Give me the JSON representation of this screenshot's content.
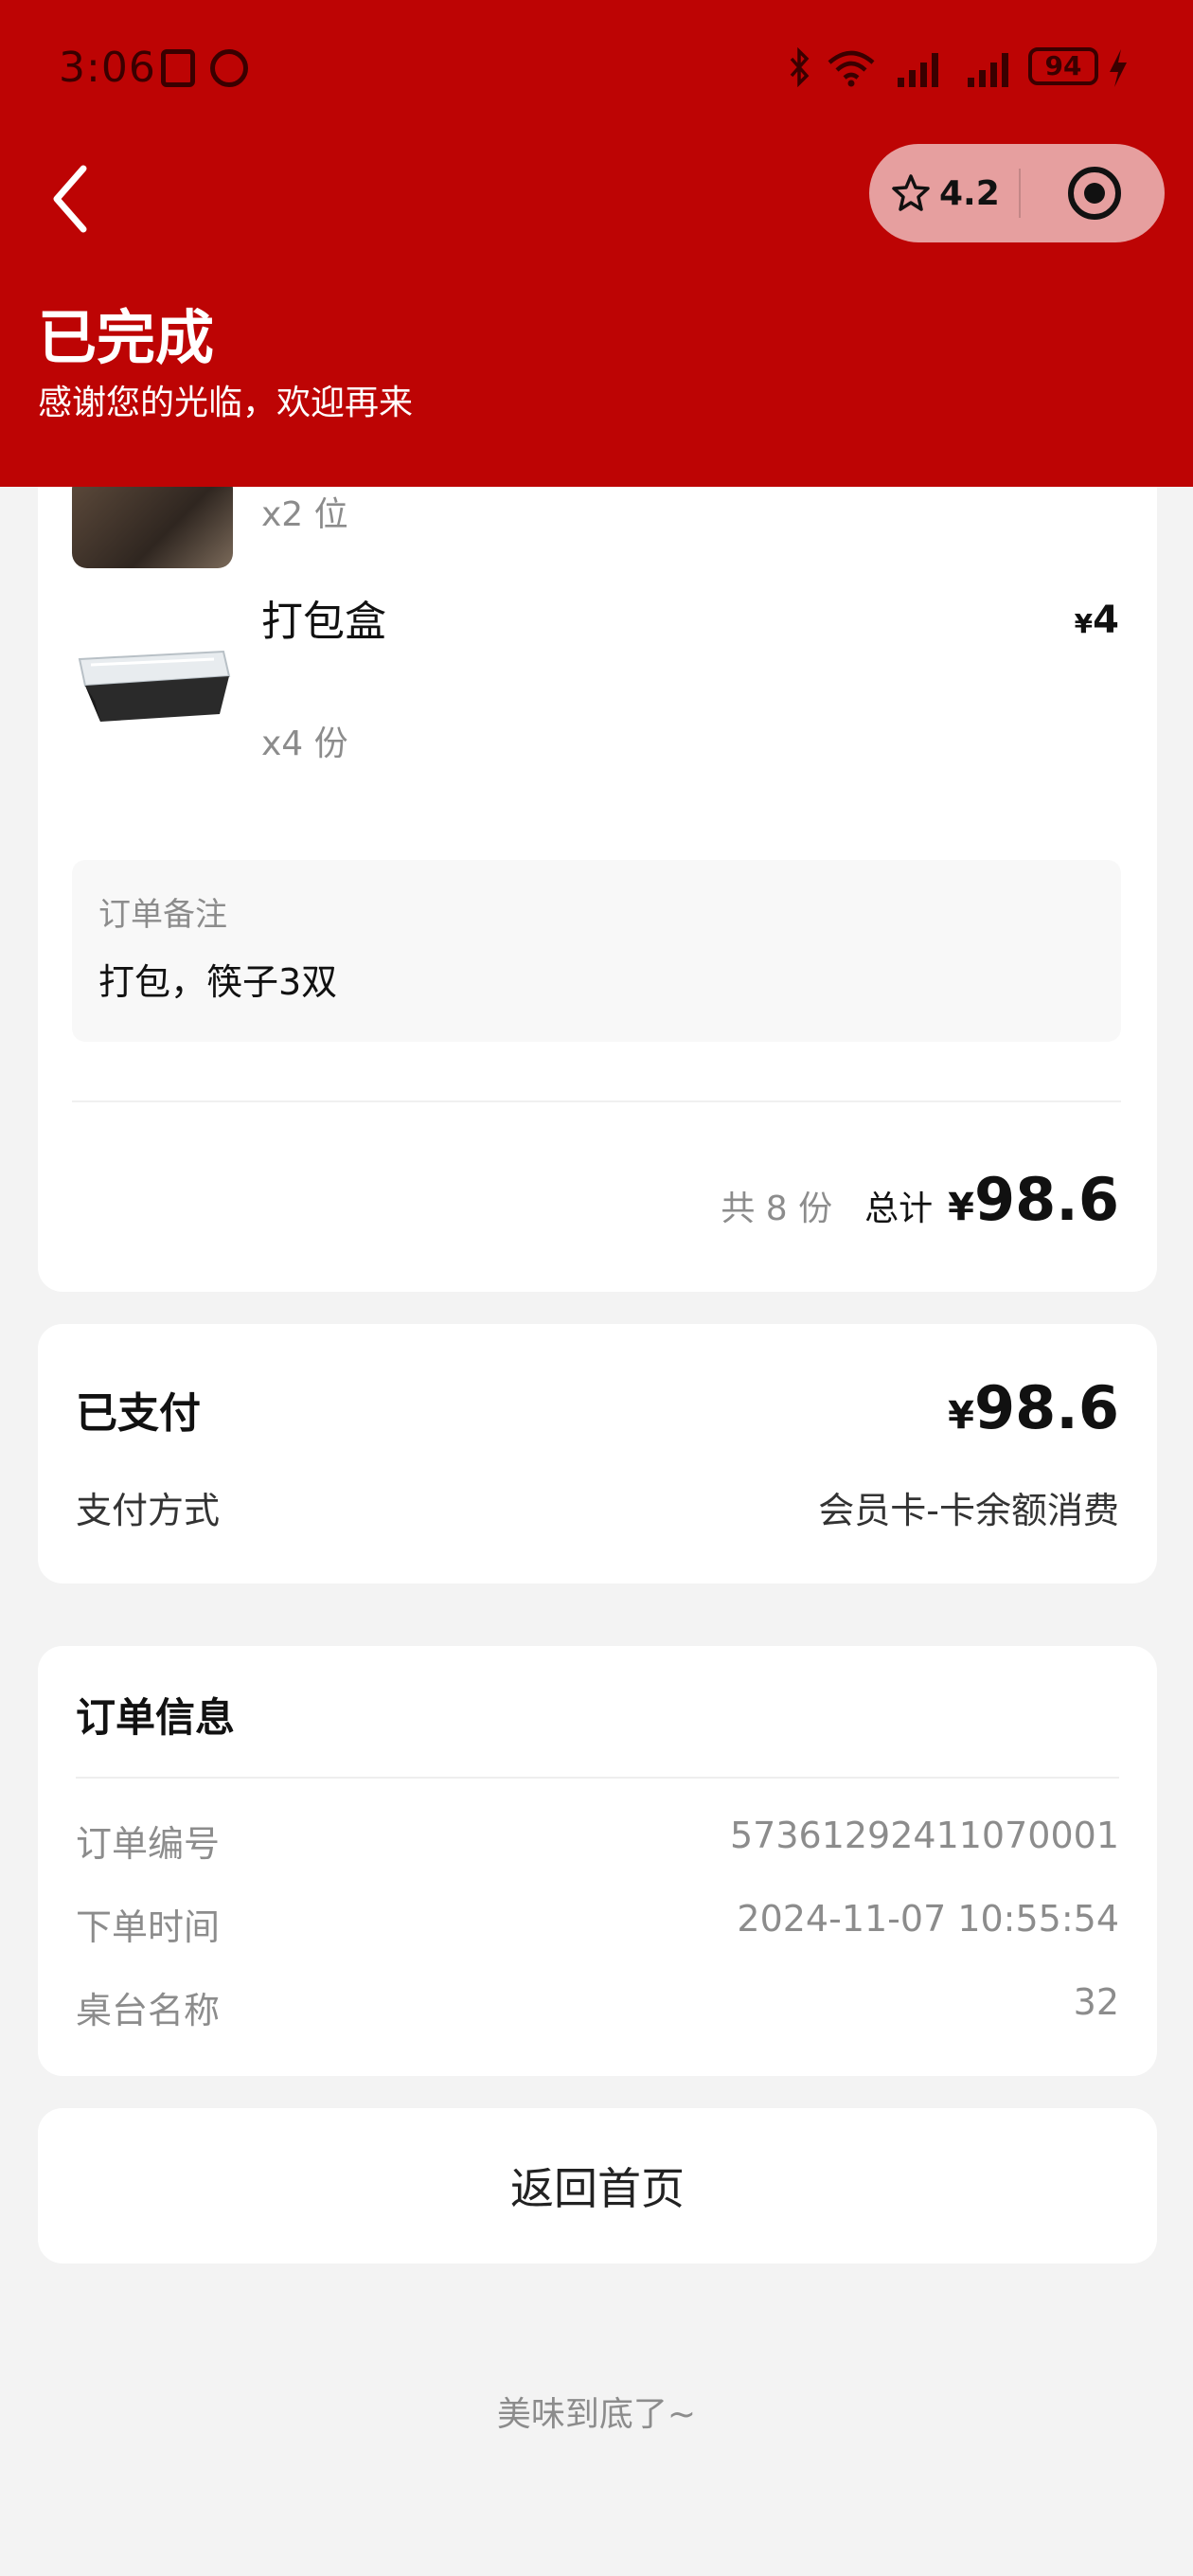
{
  "status_bar": {
    "time": "3:06",
    "battery": "94"
  },
  "header": {
    "rating": "4.2",
    "title": "已完成",
    "subtitle": "感谢您的光临，欢迎再来"
  },
  "items": [
    {
      "qty": "x2 位"
    },
    {
      "name": "打包盒",
      "price_currency": "¥",
      "price": "4",
      "qty": "x4 份"
    }
  ],
  "note": {
    "label": "订单备注",
    "text": "打包，筷子3双"
  },
  "summary": {
    "count": "共 8 份",
    "total_label": "总计",
    "currency": "¥",
    "total": "98.6"
  },
  "payment": {
    "label": "已支付",
    "currency": "¥",
    "amount": "98.6",
    "method_label": "支付方式",
    "method_value": "会员卡-卡余额消费"
  },
  "order_info": {
    "title": "订单信息",
    "rows": [
      {
        "key": "订单编号",
        "value": "57361292411070001"
      },
      {
        "key": "下单时间",
        "value": "2024-11-07 10:55:54"
      },
      {
        "key": "桌台名称",
        "value": "32"
      }
    ]
  },
  "actions": {
    "home_label": "返回首页"
  },
  "footer": {
    "end_text": "美味到底了~"
  }
}
